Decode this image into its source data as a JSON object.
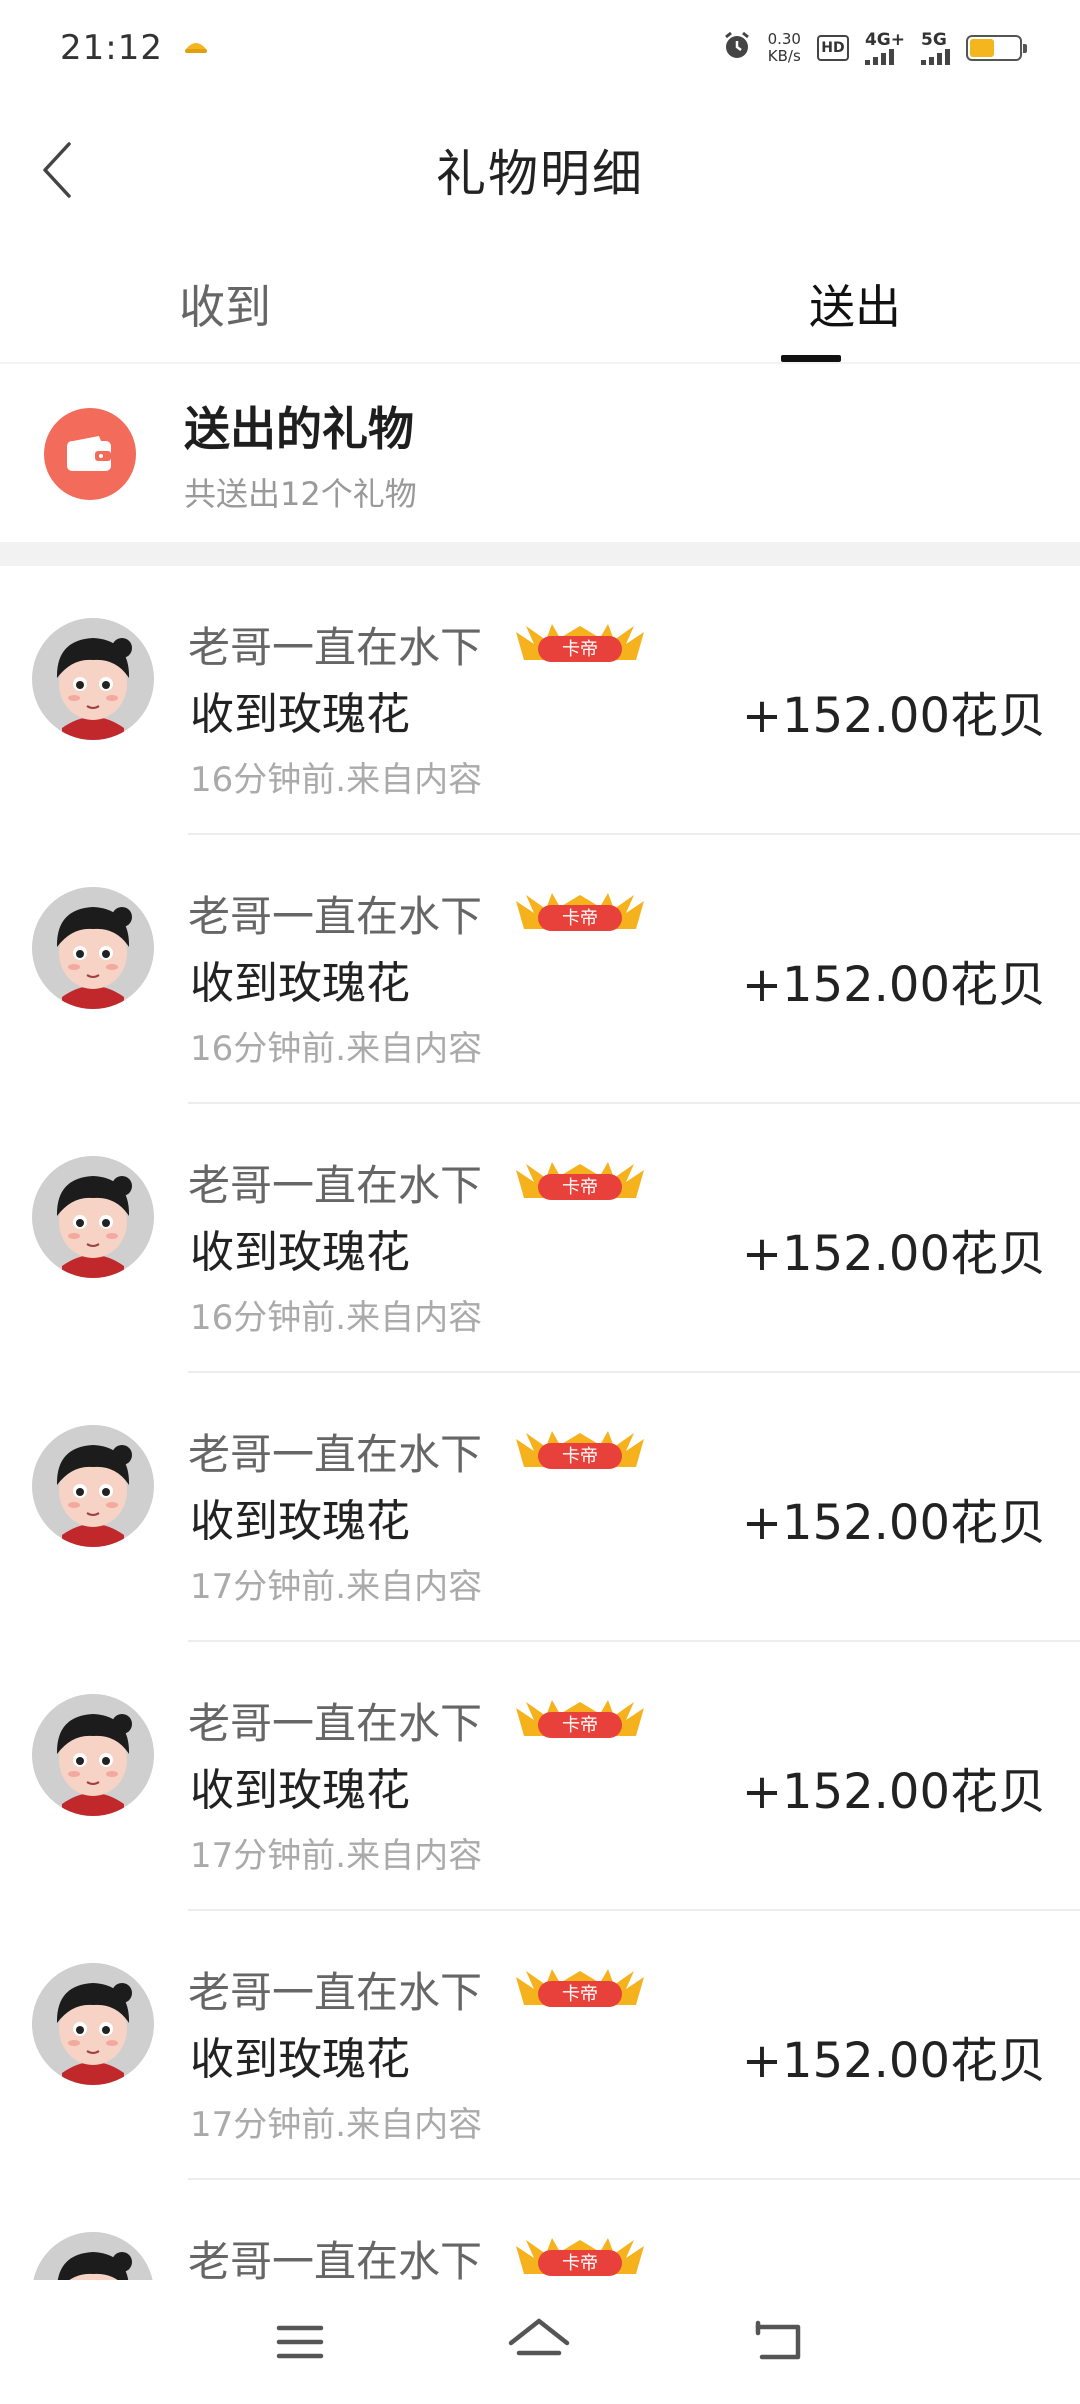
{
  "status_bar": {
    "time": "21:12",
    "net_speed_value": "0.30",
    "net_speed_unit": "KB/s",
    "hd_label": "HD",
    "sim1_label": "4G+",
    "sim2_label": "5G",
    "battery_level": 0.5,
    "battery_color": "#f5b51f"
  },
  "header": {
    "title": "礼物明细",
    "back_icon": "chevron-left-icon"
  },
  "tabs": [
    {
      "label": "收到",
      "active": false
    },
    {
      "label": "送出",
      "active": true
    }
  ],
  "summary": {
    "title": "送出的礼物",
    "subtitle": "共送出12个礼物",
    "icon": "wallet-icon",
    "icon_bg": "#f26b5b"
  },
  "gifts": [
    {
      "sender": "老哥一直在水下",
      "badge": "卡帝",
      "desc": "收到玫瑰花",
      "meta": "16分钟前.来自内容",
      "amount": "+152.00花贝"
    },
    {
      "sender": "老哥一直在水下",
      "badge": "卡帝",
      "desc": "收到玫瑰花",
      "meta": "16分钟前.来自内容",
      "amount": "+152.00花贝"
    },
    {
      "sender": "老哥一直在水下",
      "badge": "卡帝",
      "desc": "收到玫瑰花",
      "meta": "16分钟前.来自内容",
      "amount": "+152.00花贝"
    },
    {
      "sender": "老哥一直在水下",
      "badge": "卡帝",
      "desc": "收到玫瑰花",
      "meta": "17分钟前.来自内容",
      "amount": "+152.00花贝"
    },
    {
      "sender": "老哥一直在水下",
      "badge": "卡帝",
      "desc": "收到玫瑰花",
      "meta": "17分钟前.来自内容",
      "amount": "+152.00花贝"
    },
    {
      "sender": "老哥一直在水下",
      "badge": "卡帝",
      "desc": "收到玫瑰花",
      "meta": "17分钟前.来自内容",
      "amount": "+152.00花贝"
    },
    {
      "sender": "老哥一直在水下",
      "badge": "卡帝",
      "desc": "",
      "meta": "",
      "amount": ""
    }
  ],
  "bottom_nav": {
    "menu_icon": "menu-icon",
    "home_icon": "home-icon",
    "back_icon": "back-icon"
  }
}
